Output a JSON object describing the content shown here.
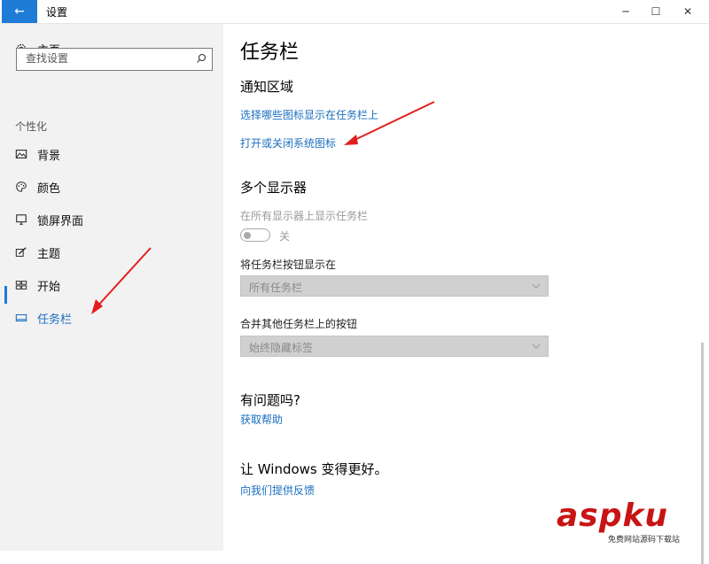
{
  "window": {
    "title": "设置",
    "back_glyph": "←",
    "minimize_glyph": "─",
    "maximize_glyph": "☐",
    "close_glyph": "✕"
  },
  "sidebar": {
    "home_label": "主页",
    "search_placeholder": "查找设置",
    "section_label": "个性化",
    "items": [
      {
        "label": "背景",
        "icon": "picture-icon"
      },
      {
        "label": "颜色",
        "icon": "palette-icon"
      },
      {
        "label": "锁屏界面",
        "icon": "monitor-icon"
      },
      {
        "label": "主题",
        "icon": "brush-icon"
      },
      {
        "label": "开始",
        "icon": "start-tiles-icon"
      },
      {
        "label": "任务栏",
        "icon": "taskbar-icon",
        "active": true
      }
    ]
  },
  "main": {
    "page_title": "任务栏",
    "notification_area": {
      "heading": "通知区域",
      "link1": "选择哪些图标显示在任务栏上",
      "link2": "打开或关闭系统图标"
    },
    "multi_display": {
      "heading": "多个显示器",
      "show_all_label": "在所有显示器上显示任务栏",
      "toggle_state": "关",
      "show_buttons_label": "将任务栏按钮显示在",
      "show_buttons_value": "所有任务栏",
      "combine_label": "合并其他任务栏上的按钮",
      "combine_value": "始终隐藏标签"
    },
    "help": {
      "heading": "有问题吗?",
      "link": "获取帮助"
    },
    "feedback": {
      "heading": "让 Windows 变得更好。",
      "link": "向我们提供反馈"
    }
  },
  "watermark": {
    "text": "aspku",
    "sub": "免费网站源码下载站"
  },
  "colors": {
    "accent": "#1e7bd6",
    "link": "#1a6fbf",
    "annotation_arrow": "#e02020"
  }
}
